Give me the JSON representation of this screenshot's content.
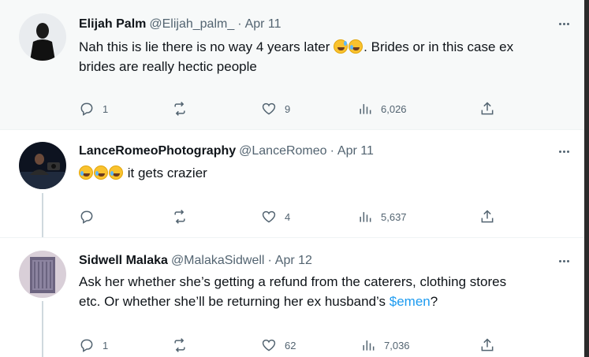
{
  "tweets": [
    {
      "name": "Elijah Palm",
      "handle": "@Elijah_palm_",
      "separator": "·",
      "date": "Apr 11",
      "text_lines": [
        "Nah this is lie there is no way 4 years later",
        ". Brides or in this case ex",
        "brides are really hectic people"
      ],
      "emojis": [
        "sweat-smile-emoji",
        "rofl-emoji"
      ],
      "replies": "1",
      "retweets": "",
      "likes": "9",
      "views": "6,026"
    },
    {
      "name": "LanceRomeoPhotography",
      "handle": "@LanceRomeo",
      "separator": "·",
      "date": "Apr 11",
      "text": "it gets crazier",
      "emojis": [
        "rofl-emoji",
        "rofl-emoji",
        "rofl-emoji"
      ],
      "replies": "",
      "retweets": "",
      "likes": "4",
      "views": "5,637"
    },
    {
      "name": "Sidwell Malaka",
      "handle": "@MalakaSidwell",
      "separator": "·",
      "date": "Apr 12",
      "text_line1": "Ask her whether she’s getting a refund from the caterers, clothing stores",
      "text_line2_pre": "etc.   Or whether she’ll be returning her ex husband’s ",
      "text_link": "$emen",
      "text_line2_post": "?",
      "replies": "1",
      "retweets": "",
      "likes": "62",
      "views": "7,036"
    }
  ],
  "colors": {
    "text": "#0f1419",
    "secondary": "#536471",
    "link": "#1d9bf0",
    "thread_line": "#cfd9de"
  }
}
